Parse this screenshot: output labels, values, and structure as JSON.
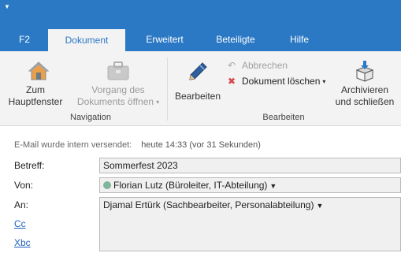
{
  "tabs": [
    "F2",
    "Dokument",
    "Erweitert",
    "Beteiligte",
    "Hilfe"
  ],
  "ribbon": {
    "zum_hauptfenster": [
      "Zum",
      "Hauptfenster"
    ],
    "vorgang": [
      "Vorgang des",
      "Dokuments öffnen"
    ],
    "navigation_label": "Navigation",
    "bearbeiten_button": "Bearbeiten",
    "abbrechen": "Abbrechen",
    "dokument_loeschen": "Dokument löschen",
    "bearbeiten_label": "Bearbeiten",
    "archivieren": [
      "Archivieren",
      "und schließen"
    ]
  },
  "mail": {
    "status": "E-Mail wurde intern versendet:",
    "time": "heute 14:33 (vor 31 Sekunden)",
    "betreff_label": "Betreff:",
    "betreff_value": "Sommerfest 2023",
    "von_label": "Von:",
    "von_value": "Florian Lutz (Büroleiter, IT-Abteilung)",
    "an_label": "An:",
    "an_value": "Djamal Ertürk (Sachbearbeiter, Personalabteilung)",
    "cc_label": "Cc",
    "xbc_label": "Xbc"
  },
  "colors": {
    "accent": "#2b78c5",
    "ribbon_bg": "#f3f3f3",
    "field_bg": "#f0f0f0"
  }
}
